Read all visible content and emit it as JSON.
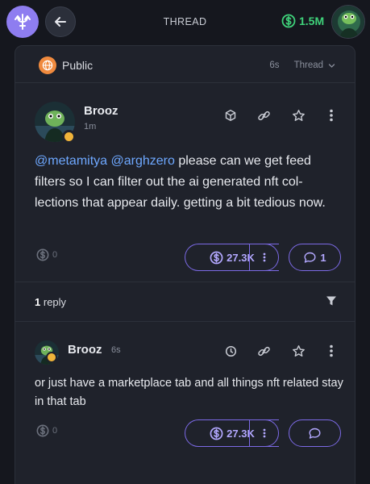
{
  "header": {
    "title": "THREAD",
    "balance": "1.5M",
    "accent": "#8e7df0",
    "balance_color": "#3fd27a"
  },
  "thread": {
    "visibility": "Public",
    "age": "6s",
    "view_mode": "Thread"
  },
  "post": {
    "author": "Brooz",
    "time": "1m",
    "mentions": [
      "@metamitya",
      "@arghzero"
    ],
    "text": "please can we get feed filters so I can filter out the ai generated nft col-lections that appear daily. getting a bit tedious now.",
    "tips": "0",
    "value": "27.3K",
    "replies": "1"
  },
  "replies_bar": {
    "count": "1",
    "label": "reply"
  },
  "reply": {
    "author": "Brooz",
    "time": "6s",
    "text": "or just have a marketplace tab and all things nft related stay in that tab",
    "tips": "0",
    "value": "27.3K"
  }
}
